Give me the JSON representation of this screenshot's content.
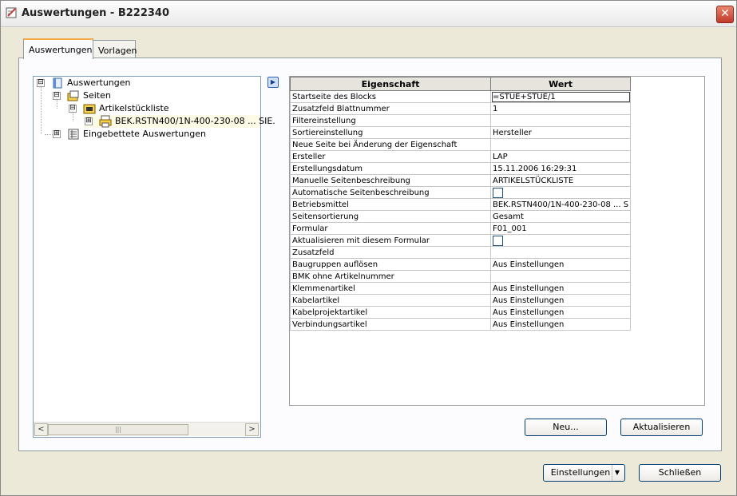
{
  "window": {
    "title": "Auswertungen - B222340",
    "close_glyph": "✕"
  },
  "tabs": [
    {
      "label": "Auswertungen",
      "active": true
    },
    {
      "label": "Vorlagen",
      "active": false
    }
  ],
  "tree": {
    "items": [
      {
        "label": "Auswertungen",
        "expander": "⊟",
        "icon": "book-icon"
      },
      {
        "label": "Seiten",
        "expander": "⊟",
        "icon": "pages-folder-icon"
      },
      {
        "label": "Artikelstückliste",
        "expander": "⊟",
        "icon": "folder-icon"
      },
      {
        "label": "BEK.RSTN400/1N-400-230-08 ... SIE.",
        "expander": "⊞",
        "icon": "printer-icon"
      },
      {
        "label": "Eingebettete Auswertungen",
        "expander": "⊞",
        "icon": "embedded-icon"
      }
    ],
    "scroll_left": "<",
    "scroll_right": ">",
    "scroll_thumb": "|||"
  },
  "play_glyph": "▶",
  "grid": {
    "headers": {
      "key": "Eigenschaft",
      "value": "Wert"
    },
    "rows": [
      {
        "key": "Startseite des Blocks",
        "value": "=STUE+STUE/1"
      },
      {
        "key": "Zusatzfeld Blattnummer",
        "value": "1"
      },
      {
        "key": "Filtereinstellung",
        "value": ""
      },
      {
        "key": "Sortiereinstellung",
        "value": "Hersteller"
      },
      {
        "key": "Neue Seite bei Änderung der Eigenschaft",
        "value": ""
      },
      {
        "key": "Ersteller",
        "value": "LAP"
      },
      {
        "key": "Erstellungsdatum",
        "value": "15.11.2006 16:29:31"
      },
      {
        "key": "Manuelle Seitenbeschreibung",
        "value": "ARTIKELSTÜCKLISTE"
      },
      {
        "key": "Automatische Seitenbeschreibung",
        "value": "",
        "checkbox": true
      },
      {
        "key": "Betriebsmittel",
        "value": "BEK.RSTN400/1N-400-230-08 ... S"
      },
      {
        "key": "Seitensortierung",
        "value": "Gesamt"
      },
      {
        "key": "Formular",
        "value": "F01_001"
      },
      {
        "key": "Aktualisieren mit diesem Formular",
        "value": "",
        "checkbox": true
      },
      {
        "key": "Zusatzfeld",
        "value": ""
      },
      {
        "key": "Baugruppen auflösen",
        "value": "Aus Einstellungen"
      },
      {
        "key": "BMK ohne Artikelnummer",
        "value": ""
      },
      {
        "key": "Klemmenartikel",
        "value": "Aus Einstellungen"
      },
      {
        "key": "Kabelartikel",
        "value": "Aus Einstellungen"
      },
      {
        "key": "Kabelprojektartikel",
        "value": "Aus Einstellungen"
      },
      {
        "key": "Verbindungsartikel",
        "value": "Aus Einstellungen"
      }
    ]
  },
  "buttons": {
    "neu": "Neu...",
    "aktualisieren": "Aktualisieren",
    "einstellungen": "Einstellungen",
    "einstellungen_arrow": "▼",
    "schliessen": "Schließen"
  }
}
